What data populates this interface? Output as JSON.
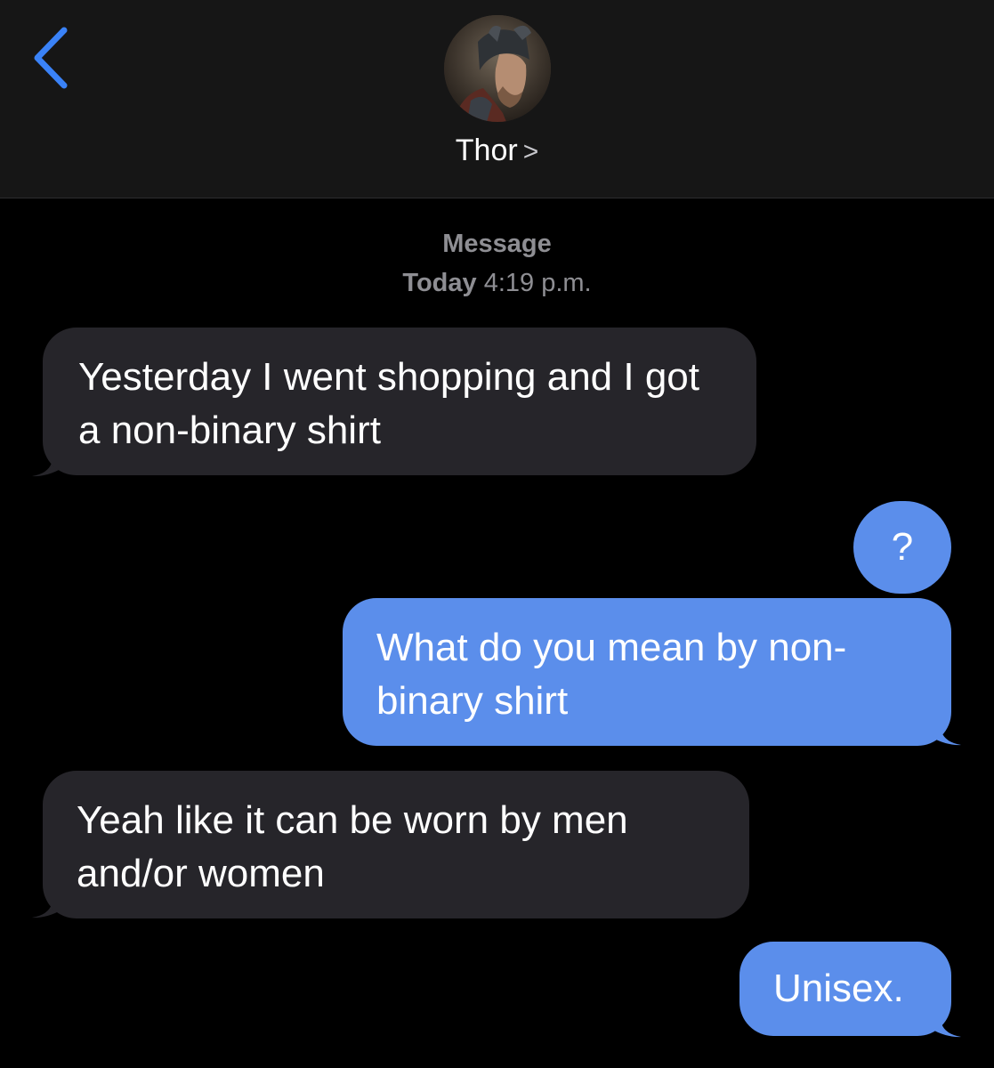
{
  "header": {
    "contact_name": "Thor",
    "chevron": ">",
    "avatar_icon": "thor-avatar"
  },
  "meta": {
    "label": "Message",
    "day": "Today",
    "time": "4:19 p.m."
  },
  "messages": [
    {
      "direction": "incoming",
      "text": "Yesterday I went shopping and I got a non-binary shirt"
    },
    {
      "direction": "outgoing",
      "text": "?"
    },
    {
      "direction": "outgoing",
      "text": "What do you mean by non-binary shirt"
    },
    {
      "direction": "incoming",
      "text": "Yeah like it can be worn by men and/or women"
    },
    {
      "direction": "outgoing",
      "text": "Unisex."
    }
  ],
  "colors": {
    "incoming_bubble": "#26252a",
    "outgoing_bubble": "#5b8eeb",
    "accent_blue": "#3a82f7",
    "background": "#000000",
    "header_background": "#161616"
  }
}
